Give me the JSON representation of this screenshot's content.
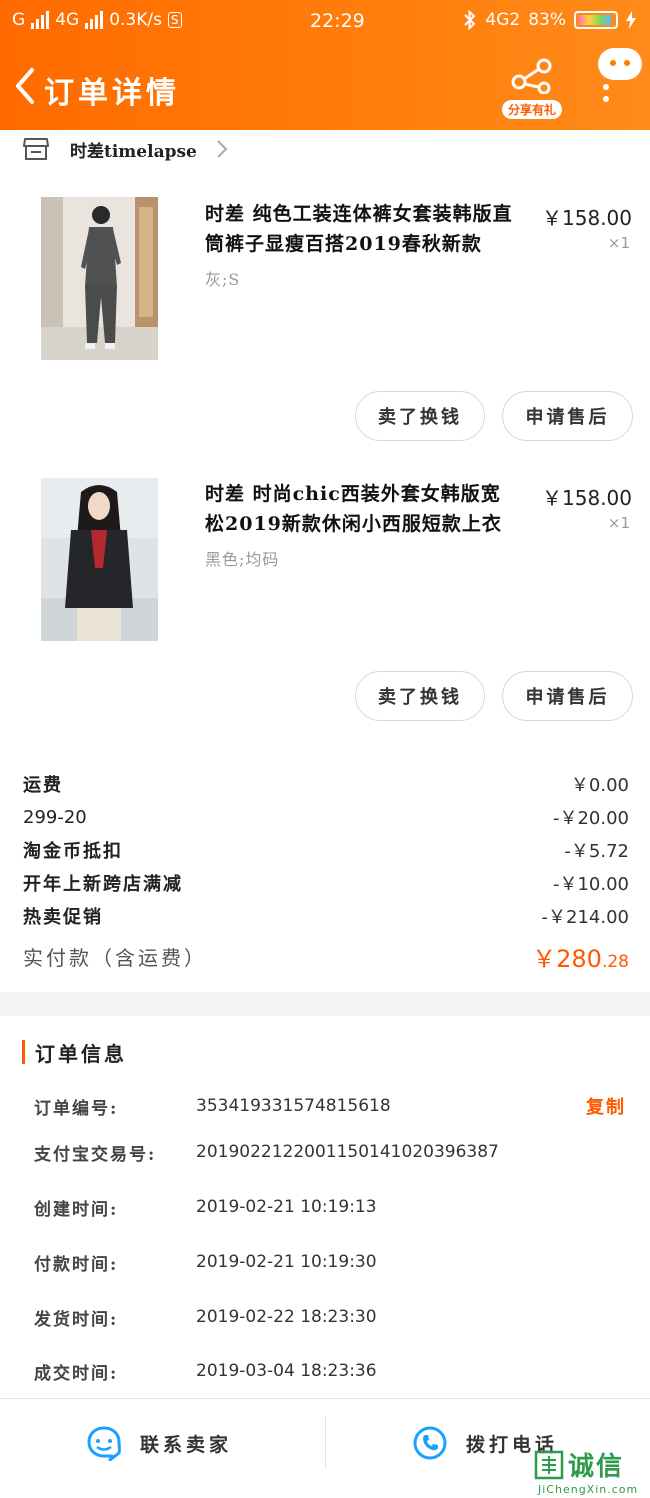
{
  "status_bar": {
    "carrier1": "G",
    "carrier2": "4G",
    "speed": "0.3K/s",
    "s_icon": "S",
    "time": "22:29",
    "net": "4G2",
    "battery": "83%"
  },
  "header": {
    "title": "订单详情",
    "share_label": "分享有礼"
  },
  "shop": {
    "name": "时差timelapse"
  },
  "items": [
    {
      "title": "时差 纯色工装连体裤女套装韩版直筒裤子显瘦百搭2019春秋新款",
      "sku": "灰;S",
      "price": "￥158.00",
      "qty": "×1",
      "btn_sell": "卖了换钱",
      "btn_after_sale": "申请售后"
    },
    {
      "title": "时差 时尚chic西装外套女韩版宽松2019新款休闲小西服短款上衣",
      "sku": "黑色;均码",
      "price": "￥158.00",
      "qty": "×1",
      "btn_sell": "卖了换钱",
      "btn_after_sale": "申请售后"
    }
  ],
  "fees": [
    {
      "label": "运费",
      "value": "￥0.00"
    },
    {
      "label": "299-20",
      "value": "-￥20.00"
    },
    {
      "label": "淘金币抵扣",
      "value": "-￥5.72"
    },
    {
      "label": "开年上新跨店满减",
      "value": "-￥10.00"
    },
    {
      "label": "热卖促销",
      "value": "-￥214.00"
    }
  ],
  "total": {
    "label": "实付款（含运费）",
    "int": "￥280",
    "dec": ".28"
  },
  "order_info": {
    "title": "订单信息",
    "copy_label": "复制",
    "rows": [
      {
        "label": "订单编号:",
        "value": "353419331574815618"
      },
      {
        "label": "支付宝交易号:",
        "value": "2019022122001150141020396387"
      },
      {
        "label": "创建时间:",
        "value": "2019-02-21 10:19:13"
      },
      {
        "label": "付款时间:",
        "value": "2019-02-21 10:19:30"
      },
      {
        "label": "发货时间:",
        "value": "2019-02-22 18:23:30"
      },
      {
        "label": "成交时间:",
        "value": "2019-03-04 18:23:36"
      }
    ]
  },
  "bottom": {
    "contact_seller": "联系卖家",
    "call": "拨打电话"
  },
  "watermark": {
    "cn": "诚信",
    "en": "JiChengXin.com"
  },
  "colors": {
    "accent": "#ff5a00",
    "header": "#ff7a0a",
    "icon_blue": "#1aa0ff"
  }
}
